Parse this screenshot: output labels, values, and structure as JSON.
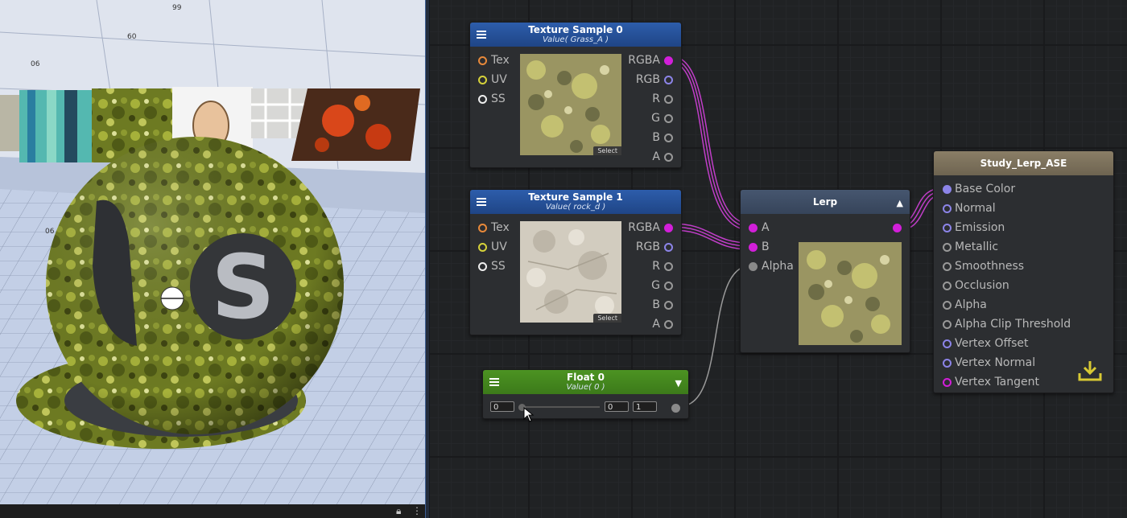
{
  "viewport": {
    "ruler_labels": [
      "06",
      "60",
      "99",
      "06"
    ],
    "sphere_logo": "S"
  },
  "nodes": {
    "texture0": {
      "title": "Texture Sample 0",
      "subtitle": "Value( Grass_A )",
      "inputs": [
        "Tex",
        "UV",
        "SS"
      ],
      "outputs": [
        "RGBA",
        "RGB",
        "R",
        "G",
        "B",
        "A"
      ],
      "select_label": "Select"
    },
    "texture1": {
      "title": "Texture Sample 1",
      "subtitle": "Value( rock_d )",
      "inputs": [
        "Tex",
        "UV",
        "SS"
      ],
      "outputs": [
        "RGBA",
        "RGB",
        "R",
        "G",
        "B",
        "A"
      ],
      "select_label": "Select"
    },
    "lerp": {
      "title": "Lerp",
      "inputs": [
        "A",
        "B",
        "Alpha"
      ]
    },
    "float0": {
      "title": "Float 0",
      "subtitle": "Value( 0 )",
      "value": "0",
      "min": "0",
      "max": "1",
      "slider_fraction": 0
    },
    "output": {
      "title": "Study_Lerp_ASE",
      "inputs": [
        "Base Color",
        "Normal",
        "Emission",
        "Metallic",
        "Smoothness",
        "Occlusion",
        "Alpha",
        "Alpha Clip Threshold",
        "Vertex Offset",
        "Vertex Normal",
        "Vertex Tangent"
      ]
    }
  },
  "colors": {
    "wire_color": "#c03ec8",
    "port_magenta": "#d21fd9",
    "port_purple": "#8c84e8",
    "port_orange": "#e8893a",
    "port_yellow": "#d6d23a",
    "port_white": "#eeeeee",
    "port_gray": "#8a8a8a"
  }
}
